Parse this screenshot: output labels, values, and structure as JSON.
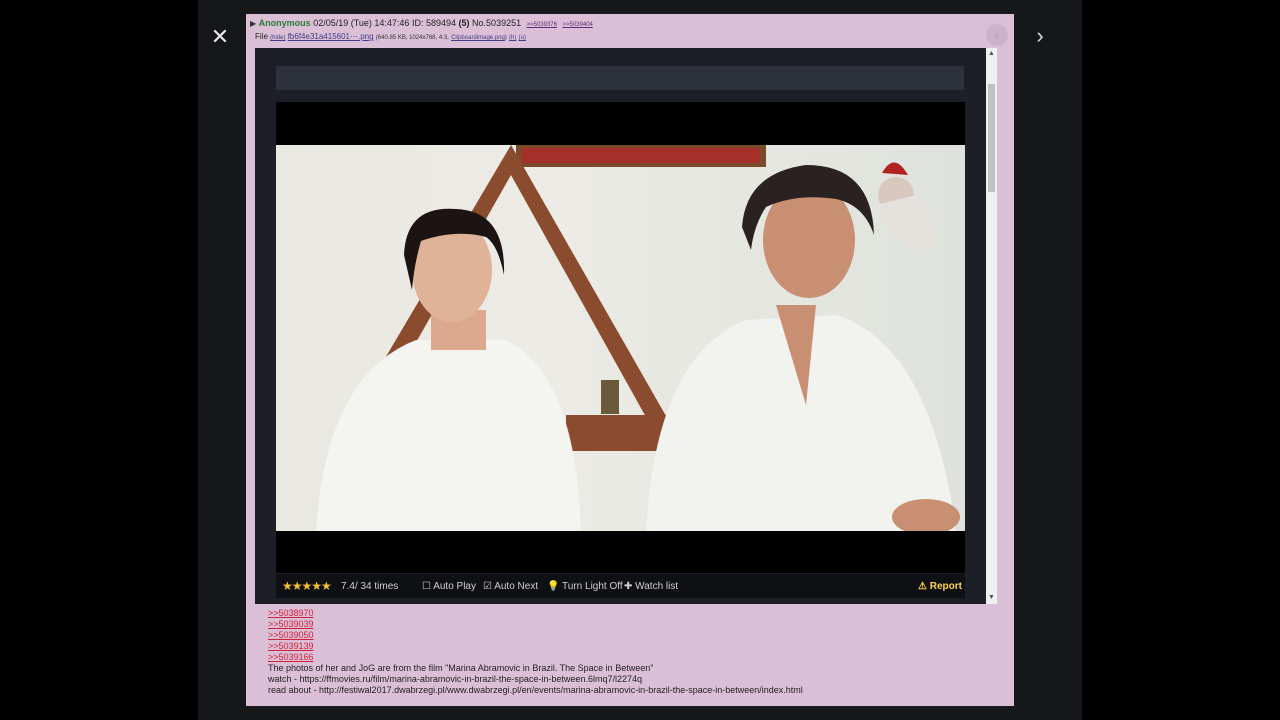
{
  "lightbox": {
    "close_icon": "close-icon",
    "next_icon": "chevron-right-icon"
  },
  "post": {
    "name": "Anonymous",
    "datetime": "02/05/19 (Tue) 14:47:46",
    "id_label": "ID: 589494",
    "id_count": "(5)",
    "number": "No.5039251",
    "backlinks": [
      ">>5039376",
      ">>5039404"
    ],
    "file": {
      "label": "File",
      "hide_label": "(hide)",
      "filename": "fb6f4e31a415601⋯.png",
      "meta": "(640.85 KB, 1024x768, 4:3,",
      "original_name": "Clipboardimage.png",
      "meta_close": ")",
      "h_link": "(h)",
      "u_link": "(u)"
    },
    "replies": [
      ">>5038970",
      ">>5039039",
      ">>5039050",
      ">>5039139",
      ">>5039166"
    ],
    "comment_lines": [
      "The photos of her and JoG are from the film \"Marina Abramovic in Brazil. The Space in Between\"",
      "watch - https://ffmovies.ru/film/marina-abramovic-in-brazil-the-space-in-between.6lmq7/l2274q",
      "read about - http://festiwal2017.dwabrzegi.pl/www.dwabrzegi.pl/en/events/marina-abramovic-in-brazil-the-space-in-between/index.html"
    ]
  },
  "player": {
    "rating_stars": "★★★★★",
    "rating_text": "7.4/ 34 times",
    "auto_play": "☐ Auto Play",
    "auto_next": "☑ Auto Next",
    "light_off": "💡 Turn Light Off",
    "watch_list": "✚ Watch list",
    "report": "⚠ Report"
  },
  "colors": {
    "post_bg": "#dbbfd6",
    "name": "#2c7a3a",
    "reply_link": "#d0203a",
    "report": "#ffd24a"
  }
}
